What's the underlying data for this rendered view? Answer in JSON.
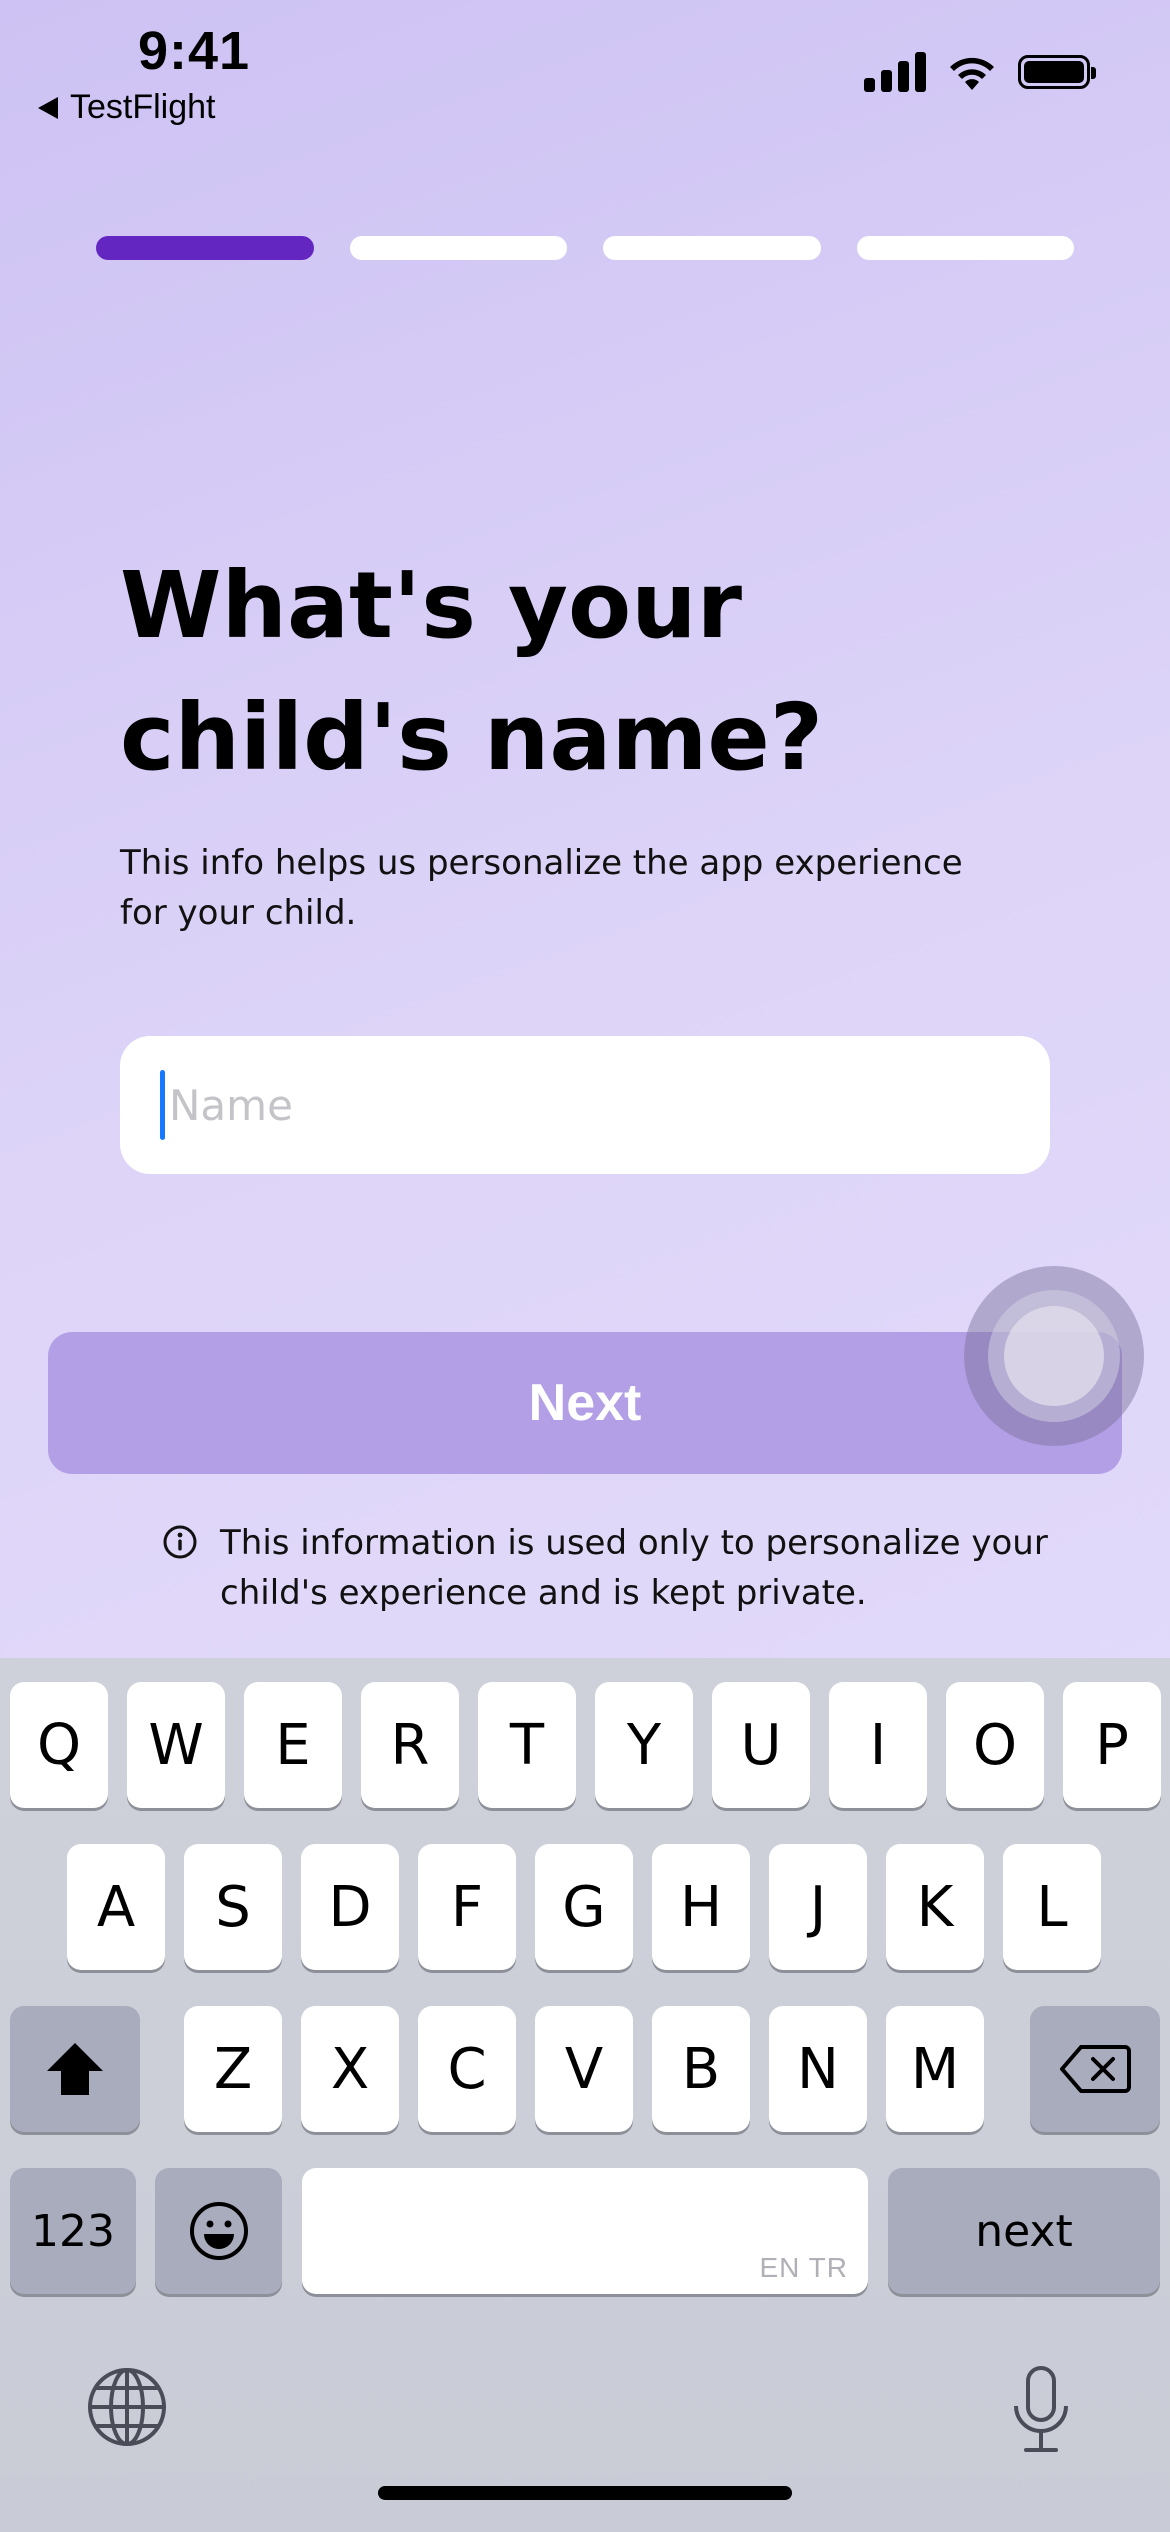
{
  "status_bar": {
    "time": "9:41",
    "back_app": "TestFlight"
  },
  "progress": {
    "steps": 4,
    "current": 1
  },
  "content": {
    "title_line1": "What's your",
    "title_line2": "child's name?",
    "subtitle": "This info helps us personalize the app experience for your child.",
    "name_placeholder": "Name",
    "name_value": "",
    "next_label": "Next",
    "info_text": "This information is used only to personalize your child's experience and is kept private."
  },
  "keyboard": {
    "row1": [
      "Q",
      "W",
      "E",
      "R",
      "T",
      "Y",
      "U",
      "I",
      "O",
      "P"
    ],
    "row2": [
      "A",
      "S",
      "D",
      "F",
      "G",
      "H",
      "J",
      "K",
      "L"
    ],
    "row3": [
      "Z",
      "X",
      "C",
      "V",
      "B",
      "N",
      "M"
    ],
    "numbers_label": "123",
    "return_label": "next",
    "space_languages": "EN TR"
  },
  "colors": {
    "accent": "#6426c0",
    "button": "#b39fe6",
    "cursor": "#1677ff"
  },
  "icons": [
    "back-triangle-icon",
    "signal-icon",
    "wifi-icon",
    "battery-icon",
    "info-icon",
    "shift-icon",
    "delete-icon",
    "emoji-icon",
    "globe-icon",
    "microphone-icon"
  ]
}
